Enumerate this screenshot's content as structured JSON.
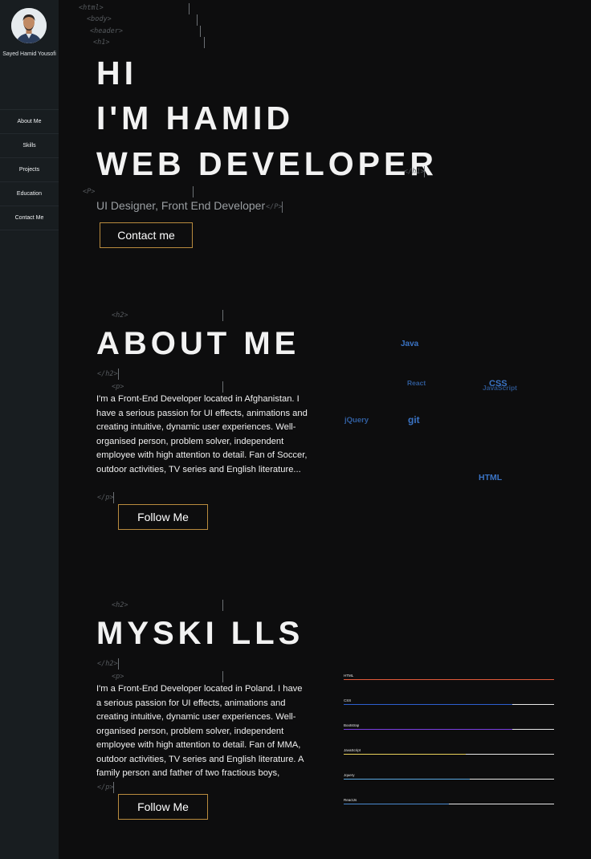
{
  "sidebar": {
    "name": "Sayed Hamid Yousofi",
    "items": [
      {
        "label": "About Me"
      },
      {
        "label": "Skills"
      },
      {
        "label": "Projects"
      },
      {
        "label": "Education"
      },
      {
        "label": "Contact Me"
      }
    ]
  },
  "tags": {
    "html": "<html>",
    "body": "<body>",
    "header": "<header>",
    "h1_open": "<h1>",
    "h1_close": "</h1>",
    "p_open_upper": "<P>",
    "p_close_upper": "</P>",
    "h2_open": "<h2>",
    "h2_close": "</h2>",
    "p_open": "<p>",
    "p_close": "</p>"
  },
  "hero": {
    "line1": "HI",
    "line2": "I'M HAMID",
    "line3": "WEB DEVELOPER",
    "subtitle": "UI Designer, Front End Developer",
    "contact_button": "Contact me"
  },
  "about": {
    "title": "ABOUT ME",
    "text": "I'm a Front-End Developer located in Afghanistan. I have a serious passion for UI effects, animations and creating intuitive, dynamic user experiences. Well-organised person, problem solver, independent employee with high attention to detail. Fan of Soccer, outdoor activities, TV series and English literature...",
    "button": "Follow Me"
  },
  "tag_cloud": {
    "color": "#3a73c4",
    "words": [
      "Java",
      "React",
      "CSS",
      "JavaScript",
      "jQuery",
      "git",
      "HTML"
    ]
  },
  "skills": {
    "title": "MYSKI LLS",
    "text": "I'm a Front-End Developer located in Poland. I have a serious passion for UI effects, animations and creating intuitive, dynamic user experiences. Well-organised person, problem solver, independent employee with high attention to detail. Fan of MMA, outdoor activities, TV series and English literature. A family person and father of two fractious boys,",
    "button": "Follow Me",
    "bars": [
      {
        "label": "HTML",
        "percent": 100,
        "color": "#e0593a"
      },
      {
        "label": "CSS",
        "percent": 80,
        "color": "#2d5fd0"
      },
      {
        "label": "Bootstrap",
        "percent": 80,
        "color": "#7b3fe0"
      },
      {
        "label": "JavaScript",
        "percent": 58,
        "color": "#e8d15a"
      },
      {
        "label": "Jquery",
        "percent": 60,
        "color": "#5aa8e0"
      },
      {
        "label": "ReactJs",
        "percent": 50,
        "color": "#4a8ad0"
      }
    ]
  }
}
